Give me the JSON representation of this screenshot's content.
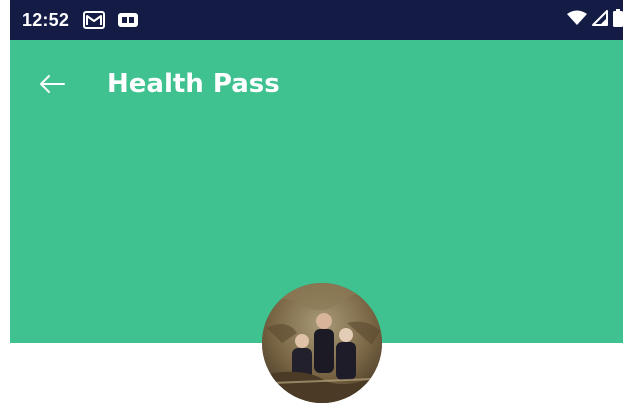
{
  "status_bar": {
    "time": "12:52",
    "icons": [
      "gmail-icon",
      "notification-badge-icon",
      "wifi-icon",
      "cell-signal-icon",
      "battery-icon"
    ]
  },
  "app_bar": {
    "title": "Health Pass",
    "back_icon": "arrow-left-icon"
  },
  "colors": {
    "status_bar": "#141c46",
    "app_bar": "#40c290",
    "background": "#ffffff"
  },
  "profile": {
    "avatar_icon": "profile-photo"
  }
}
